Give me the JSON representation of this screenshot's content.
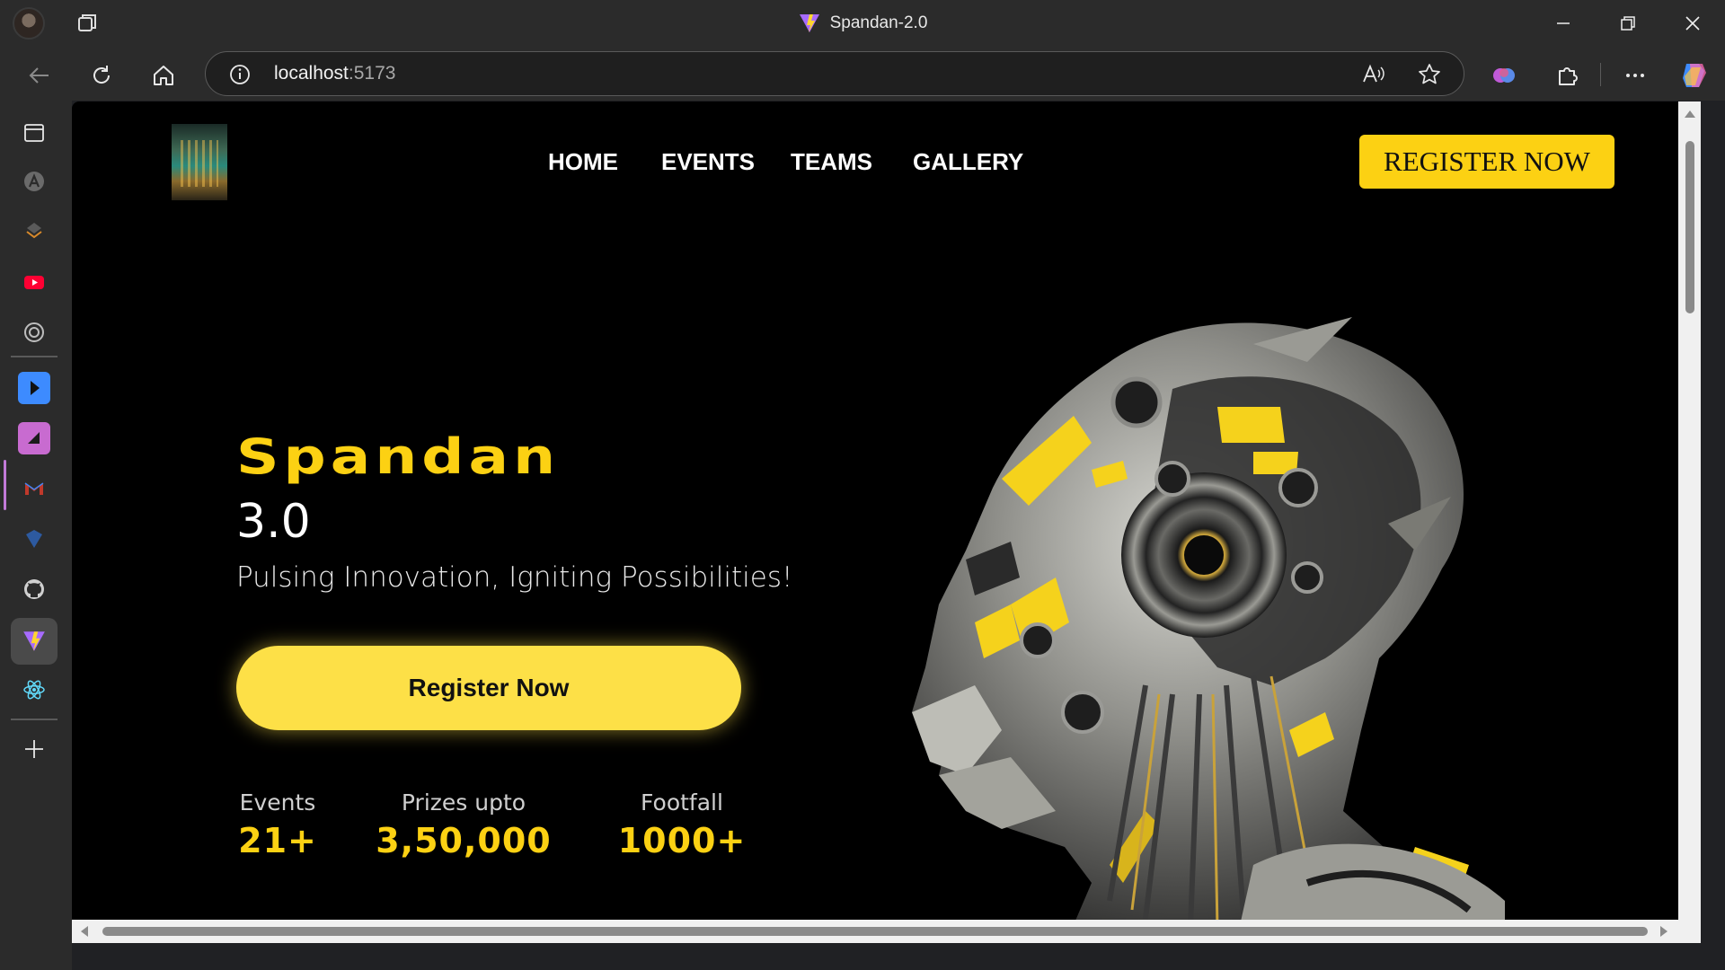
{
  "window": {
    "title": "Spandan-2.0"
  },
  "address_bar": {
    "host": "localhost",
    "port": ":5173"
  },
  "site": {
    "nav": [
      {
        "label": "HOME"
      },
      {
        "label": "EVENTS"
      },
      {
        "label": "TEAMS"
      },
      {
        "label": "GALLERY"
      }
    ],
    "register_top": "REGISTER NOW",
    "hero_title": "Spandan",
    "hero_version": "3.0",
    "tagline": "Pulsing Innovation, Igniting Possibilities!",
    "register_button": "Register Now",
    "stats": [
      {
        "label": "Events",
        "value": "21+"
      },
      {
        "label": "Prizes upto",
        "value": "3,50,000"
      },
      {
        "label": "Footfall",
        "value": "1000+"
      }
    ]
  },
  "colors": {
    "accent": "#fcd113",
    "background": "#000000",
    "chrome": "#2b2b2b"
  }
}
